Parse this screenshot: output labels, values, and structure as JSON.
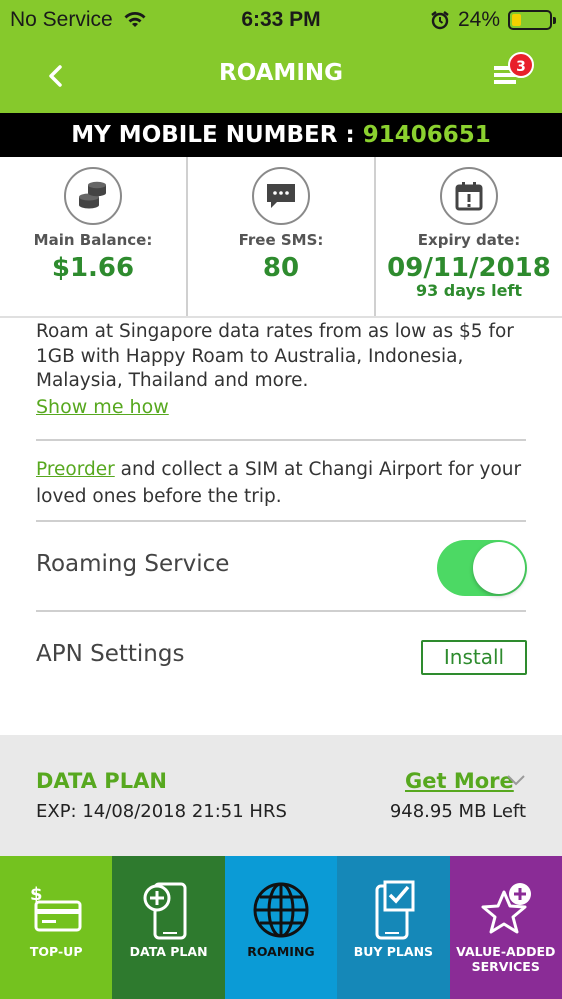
{
  "status_bar": {
    "carrier": "No Service",
    "time": "6:33 PM",
    "battery": "24%",
    "battery_level": 0.24
  },
  "nav": {
    "title": "ROAMING",
    "badge": "3"
  },
  "mobile": {
    "label": "MY MOBILE NUMBER :",
    "number": "91406651"
  },
  "stats": {
    "balance": {
      "label": "Main Balance:",
      "value": "$1.66"
    },
    "sms": {
      "label": "Free SMS:",
      "value": "80"
    },
    "expiry": {
      "label": "Expiry date:",
      "value": "09/11/2018",
      "sub": "93 days left"
    }
  },
  "promo": {
    "text": "Roam at Singapore data rates from as low as $5 for 1GB with Happy Roam to Australia, Indonesia, Malaysia, Thailand and more.",
    "link": "Show me how"
  },
  "preorder": {
    "link": "Preorder",
    "text": " and collect a SIM at Changi Airport for your loved ones before the trip."
  },
  "roaming_service": {
    "label": "Roaming Service",
    "enabled": true
  },
  "apn": {
    "label": "APN Settings",
    "button": "Install"
  },
  "data_plan": {
    "title": "DATA PLAN",
    "expiry": "EXP: 14/08/2018 21:51 HRS",
    "more": "Get More",
    "left": "948.95 MB Left"
  },
  "tabs": [
    {
      "label": "TOP-UP",
      "icon": "topup-card-icon",
      "color": "#74c21f"
    },
    {
      "label": "DATA PLAN",
      "icon": "phone-plus-icon",
      "color": "#2e7a2e"
    },
    {
      "label": "ROAMING",
      "icon": "globe-icon",
      "color": "#0b9bd6"
    },
    {
      "label": "BUY PLANS",
      "icon": "phone-check-icon",
      "color": "#1588b8"
    },
    {
      "label": "VALUE-ADDED SERVICES",
      "icon": "star-plus-icon",
      "color": "#8a2c96"
    }
  ],
  "colors": {
    "brand_green": "#86c92c",
    "accent_green": "#2e8b2e",
    "link_green": "#57a81f",
    "toggle_on": "#4cd964"
  }
}
